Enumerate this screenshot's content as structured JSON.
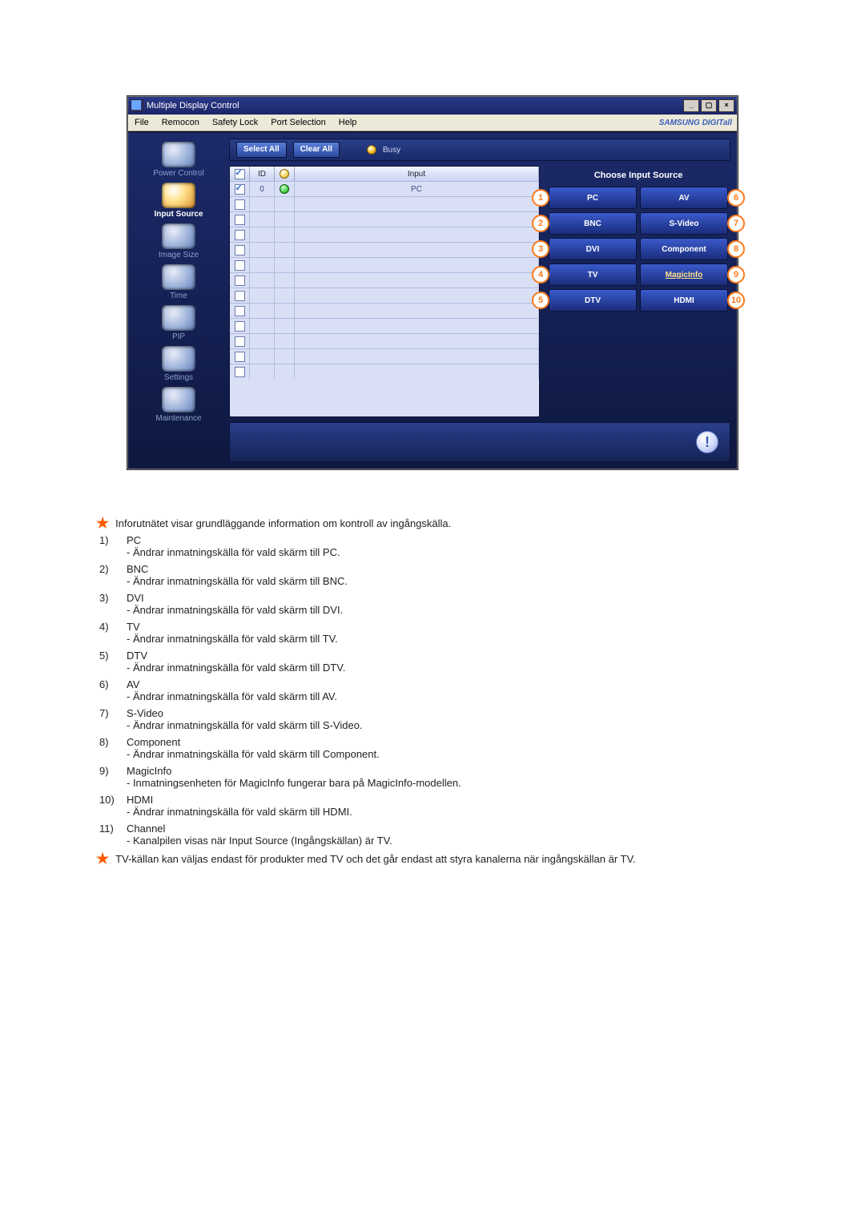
{
  "app": {
    "title": "Multiple Display Control",
    "brand": "SAMSUNG DIGITall"
  },
  "menu": [
    "File",
    "Remocon",
    "Safety Lock",
    "Port Selection",
    "Help"
  ],
  "sidebar": [
    {
      "label": "Power Control",
      "active": false
    },
    {
      "label": "Input Source",
      "active": true
    },
    {
      "label": "Image Size",
      "active": false
    },
    {
      "label": "Time",
      "active": false
    },
    {
      "label": "PIP",
      "active": false
    },
    {
      "label": "Settings",
      "active": false
    },
    {
      "label": "Maintenance",
      "active": false
    }
  ],
  "toolbar": {
    "select_all": "Select All",
    "clear_all": "Clear All",
    "busy": "Busy"
  },
  "table": {
    "headers": {
      "id": "ID",
      "input": "Input"
    },
    "row0": {
      "id": "0",
      "input": "PC"
    }
  },
  "panel": {
    "title": "Choose Input Source"
  },
  "sources": {
    "left": [
      {
        "num": "1",
        "label": "PC"
      },
      {
        "num": "2",
        "label": "BNC"
      },
      {
        "num": "3",
        "label": "DVI"
      },
      {
        "num": "4",
        "label": "TV"
      },
      {
        "num": "5",
        "label": "DTV"
      }
    ],
    "right": [
      {
        "num": "6",
        "label": "AV"
      },
      {
        "num": "7",
        "label": "S-Video"
      },
      {
        "num": "8",
        "label": "Component"
      },
      {
        "num": "9",
        "label": "MagicInfo"
      },
      {
        "num": "10",
        "label": "HDMI"
      }
    ]
  },
  "doc": {
    "starnote": "Inforutnätet visar grundläggande information om kontroll av ingångskälla.",
    "items": [
      {
        "n": "1)",
        "t": "PC",
        "d": "- Ändrar inmatningskälla för vald skärm till PC."
      },
      {
        "n": "2)",
        "t": "BNC",
        "d": "- Ändrar inmatningskälla för vald skärm till BNC."
      },
      {
        "n": "3)",
        "t": "DVI",
        "d": "- Ändrar inmatningskälla för vald skärm till DVI."
      },
      {
        "n": "4)",
        "t": "TV",
        "d": "- Ändrar inmatningskälla för vald skärm till TV."
      },
      {
        "n": "5)",
        "t": "DTV",
        "d": "- Ändrar inmatningskälla för vald skärm till DTV."
      },
      {
        "n": "6)",
        "t": "AV",
        "d": "- Ändrar inmatningskälla för vald skärm till AV."
      },
      {
        "n": "7)",
        "t": "S-Video",
        "d": "- Ändrar inmatningskälla för vald skärm till S-Video."
      },
      {
        "n": "8)",
        "t": "Component",
        "d": "- Ändrar inmatningskälla för vald skärm till Component."
      },
      {
        "n": "9)",
        "t": "MagicInfo",
        "d": "- Inmatningsenheten för MagicInfo fungerar bara på MagicInfo-modellen."
      },
      {
        "n": "10)",
        "t": "HDMI",
        "d": "- Ändrar inmatningskälla för vald skärm till HDMI."
      },
      {
        "n": "11)",
        "t": "Channel",
        "d": "- Kanalpilen visas när Input Source (Ingångskällan) är TV."
      }
    ],
    "starnote2": "TV-källan kan väljas endast för produkter med TV och det går endast att styra kanalerna när ingångskällan är TV."
  }
}
